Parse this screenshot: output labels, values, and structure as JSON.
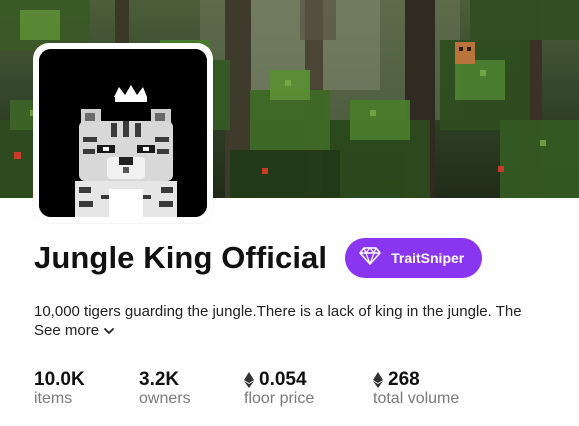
{
  "collection": {
    "title": "Jungle King Official",
    "badge_label": "TraitSniper",
    "description": "10,000 tigers guarding the jungle.There is a lack of king in the jungle. The",
    "see_more_label": "See more"
  },
  "stats": [
    {
      "value": "10.0K",
      "label": "items",
      "currency_icon": ""
    },
    {
      "value": "3.2K",
      "label": "owners",
      "currency_icon": ""
    },
    {
      "value": "0.054",
      "label": "floor price",
      "currency_icon": "ethereum-icon"
    },
    {
      "value": "268",
      "label": "total volume",
      "currency_icon": "ethereum-icon"
    }
  ],
  "colors": {
    "badge_background": "#8a35f0",
    "label_gray": "#7a7a7a",
    "avatar_background": "#000000"
  },
  "icons": {
    "badge": "diamond-icon",
    "see_more": "chevron-down-icon",
    "currency": "ethereum-icon"
  }
}
